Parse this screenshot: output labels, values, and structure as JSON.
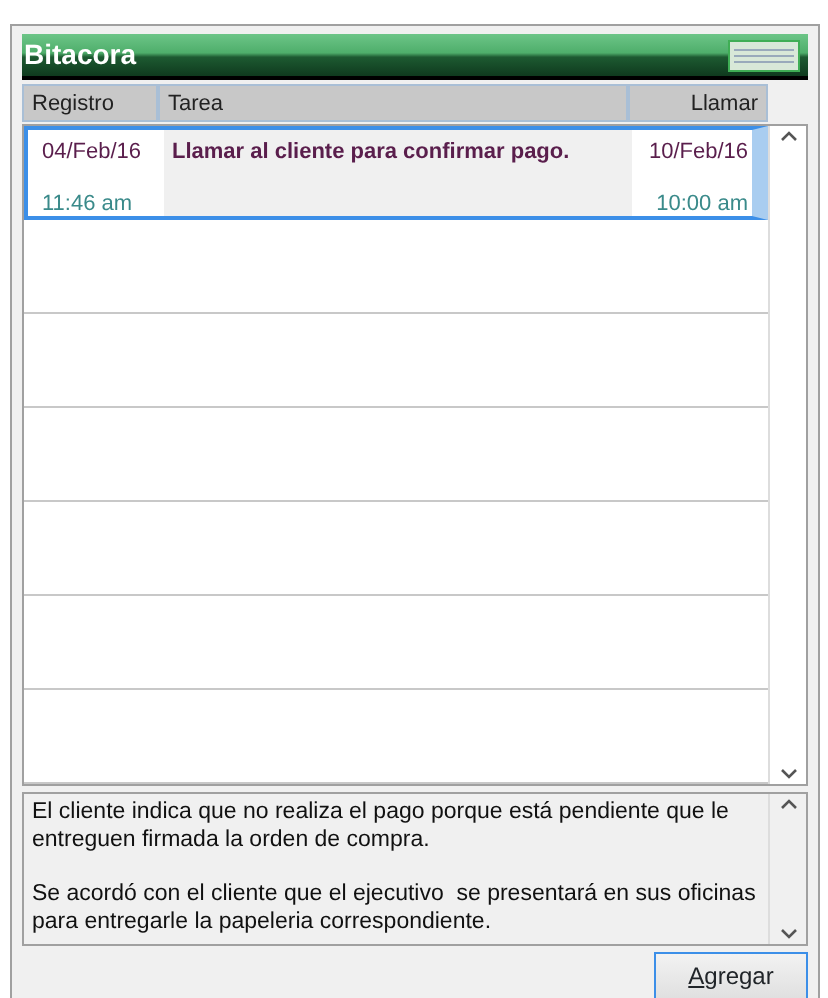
{
  "window": {
    "title": "Bitacora"
  },
  "table": {
    "columns": [
      "Registro",
      "Tarea",
      "Llamar"
    ],
    "rows": [
      {
        "registro_fecha": "04/Feb/16",
        "registro_hora": "11:46 am",
        "tarea": "Llamar al cliente para confirmar pago.",
        "llamar_fecha": "10/Feb/16",
        "llamar_hora": "10:00 am",
        "selected": true
      }
    ]
  },
  "notes": {
    "text": "El cliente indica que no realiza el pago porque está pendiente que le entreguen firmada la orden de compra.\n\nSe acordó con el cliente que el ejecutivo  se presentará en sus oficinas para entregarle la papeleria correspondiente."
  },
  "buttons": [
    "Agregar"
  ]
}
